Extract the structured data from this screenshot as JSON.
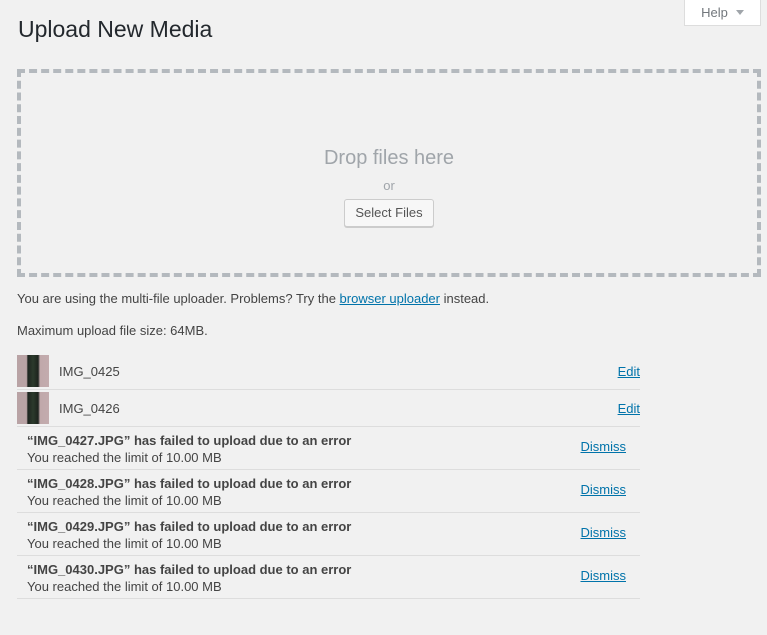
{
  "help": {
    "label": "Help"
  },
  "page": {
    "title": "Upload New Media"
  },
  "drop_area": {
    "title": "Drop files here",
    "or_text": "or",
    "select_button": "Select Files"
  },
  "uploader_note": {
    "before": "You are using the multi-file uploader. Problems? Try the ",
    "link": "browser uploader",
    "after": " instead."
  },
  "max_size": "Maximum upload file size: 64MB.",
  "media": [
    {
      "name": "IMG_0425",
      "action": "Edit"
    },
    {
      "name": "IMG_0426",
      "action": "Edit"
    }
  ],
  "errors": [
    {
      "title": "“IMG_0427.JPG” has failed to upload due to an error",
      "message": "You reached the limit of 10.00 MB",
      "action": "Dismiss"
    },
    {
      "title": "“IMG_0428.JPG” has failed to upload due to an error",
      "message": "You reached the limit of 10.00 MB",
      "action": "Dismiss"
    },
    {
      "title": "“IMG_0429.JPG” has failed to upload due to an error",
      "message": "You reached the limit of 10.00 MB",
      "action": "Dismiss"
    },
    {
      "title": "“IMG_0430.JPG” has failed to upload due to an error",
      "message": "You reached the limit of 10.00 MB",
      "action": "Dismiss"
    }
  ]
}
